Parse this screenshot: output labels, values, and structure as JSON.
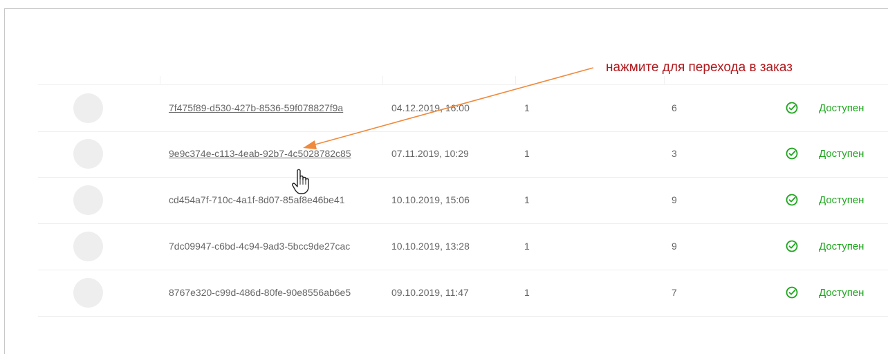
{
  "annotation": {
    "text": "нажмите для перехода в заказ",
    "color": "#b0181c"
  },
  "status_color": "#1ea51e",
  "icons": {
    "status": "check-circle-icon",
    "cursor": "hand-pointer-icon",
    "arrow": "annotation-arrow-icon"
  },
  "orders": [
    {
      "id": "7f475f89-d530-427b-8536-59f078827f9a",
      "date": "04.12.2019, 16:00",
      "qty": "1",
      "count": "6",
      "status": "Доступен"
    },
    {
      "id": "9e9c374e-c113-4eab-92b7-4c5028782c85",
      "date": "07.11.2019, 10:29",
      "qty": "1",
      "count": "3",
      "status": "Доступен"
    },
    {
      "id": "cd454a7f-710c-4a1f-8d07-85af8e46be41",
      "date": "10.10.2019, 15:06",
      "qty": "1",
      "count": "9",
      "status": "Доступен"
    },
    {
      "id": "7dc09947-c6bd-4c94-9ad3-5bcc9de27cac",
      "date": "10.10.2019, 13:28",
      "qty": "1",
      "count": "9",
      "status": "Доступен"
    },
    {
      "id": "8767e320-c99d-486d-80fe-90e8556ab6e5",
      "date": "09.10.2019, 11:47",
      "qty": "1",
      "count": "7",
      "status": "Доступен"
    }
  ]
}
